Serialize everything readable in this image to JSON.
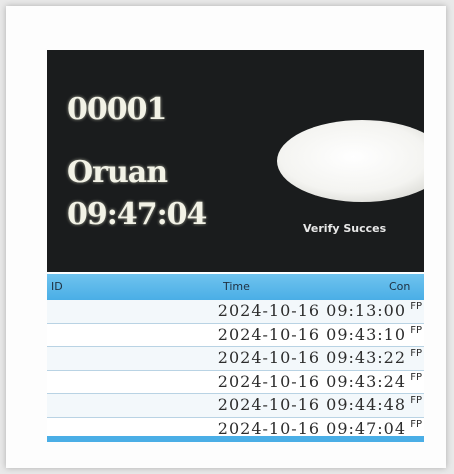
{
  "device": {
    "user_id": "00001",
    "user_name": "Oruan",
    "time": "09:47:04",
    "verify_text": "Verify Succes"
  },
  "log": {
    "columns": [
      "ID",
      "Time",
      "Con"
    ],
    "rows": [
      {
        "time": "2024-10-16 09:13:00",
        "con": "FP"
      },
      {
        "time": "2024-10-16 09:43:10",
        "con": "FP"
      },
      {
        "time": "2024-10-16 09:43:22",
        "con": "FP"
      },
      {
        "time": "2024-10-16 09:43:24",
        "con": "FP"
      },
      {
        "time": "2024-10-16 09:44:48",
        "con": "FP"
      },
      {
        "time": "2024-10-16 09:47:04",
        "con": "FP"
      }
    ]
  }
}
